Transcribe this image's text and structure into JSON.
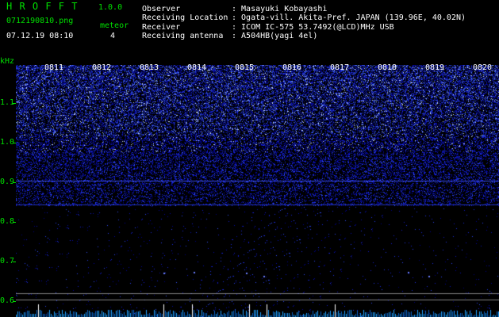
{
  "app": {
    "name": "H R O F F T",
    "version": "1.0.0",
    "filename": "0712190810.png",
    "datetime": "07.12.19 08:10",
    "meteor_label": "meteor",
    "meteor_count": "4"
  },
  "info": {
    "observer_label": "Observer",
    "observer_value": ": Masayuki Kobayashi",
    "location_label": "Receiving Location",
    "location_value": ": Ogata-vill. Akita-Pref. JAPAN (139.96E, 40.02N)",
    "receiver_label": "Receiver",
    "receiver_value": ": ICOM IC-575 53.7492(@LCD)MHz USB",
    "antenna_label": "Receiving antenna",
    "antenna_value": ": A504HB(yagi 4el)"
  },
  "axis": {
    "unit": "kHz",
    "ticks": [
      {
        "label": "1.1",
        "value": 1.1
      },
      {
        "label": "1.0",
        "value": 1.0
      },
      {
        "label": "0.9",
        "value": 0.9
      },
      {
        "label": "0.8",
        "value": 0.8
      },
      {
        "label": "0.7",
        "value": 0.7
      },
      {
        "label": "0.6",
        "value": 0.6
      }
    ],
    "times": [
      "0811",
      "0812",
      "0813",
      "0814",
      "0815",
      "0816",
      "0817",
      "0818",
      "0819",
      "0820"
    ]
  },
  "colors": {
    "label_green": "#00e000",
    "text_white": "#ffffff",
    "noise_blue": "#2030ff",
    "background": "#000000"
  }
}
